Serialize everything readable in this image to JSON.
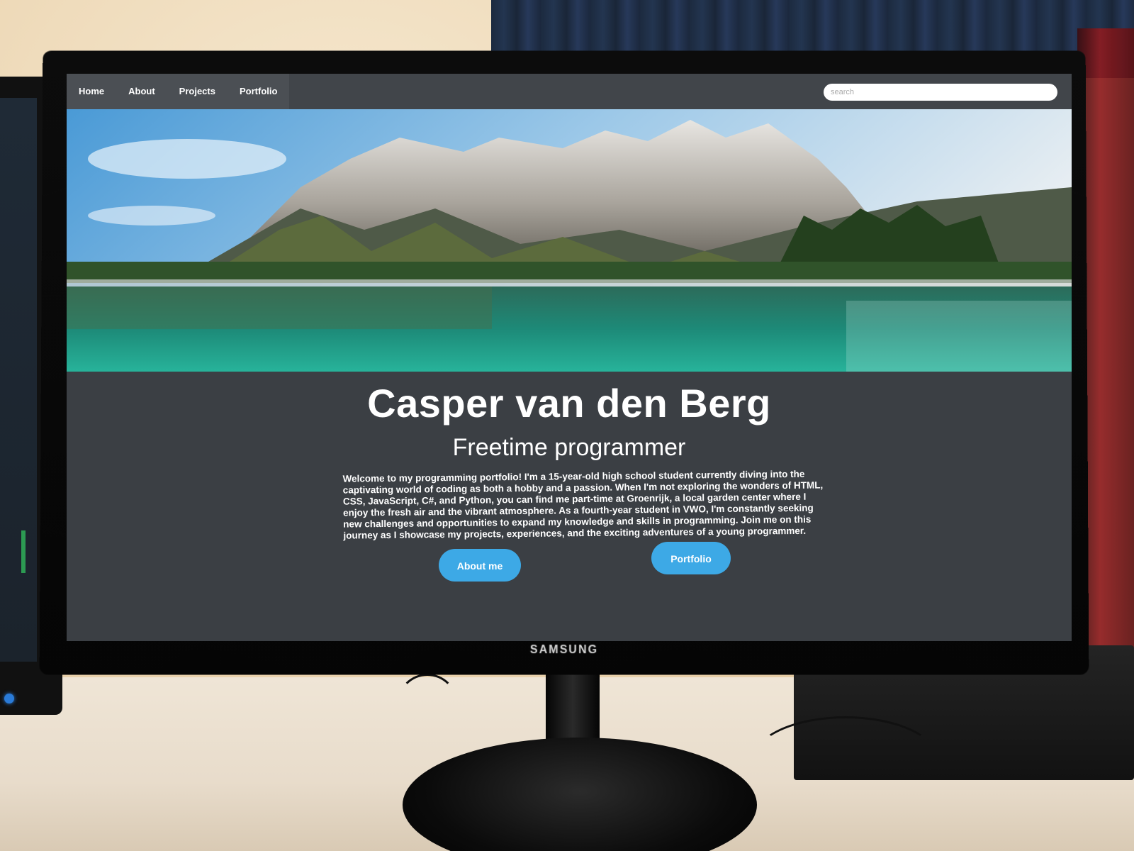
{
  "site": {
    "nav": {
      "links": [
        "Home",
        "About",
        "Projects",
        "Portfolio"
      ],
      "search_placeholder": "search"
    },
    "hero": {
      "title": "Casper van den Berg",
      "subtitle": "Freetime programmer",
      "intro": "Welcome to my programming portfolio! I'm a 15-year-old high school student currently diving into the captivating world of coding as both a hobby and a passion. When I'm not exploring the wonders of HTML, CSS, JavaScript, C#, and Python, you can find me part-time at Groenrijk, a local garden center where I enjoy the fresh air and the vibrant atmosphere. As a fourth-year student in VWO, I'm constantly seeking new challenges and opportunities to expand my knowledge and skills in programming. Join me on this journey as I showcase my projects, experiences, and the exciting adventures of a young programmer.",
      "buttons": {
        "about": "About me",
        "portfolio": "Portfolio"
      }
    }
  },
  "monitor": {
    "brand": "SAMSUNG"
  },
  "colors": {
    "page_bg": "#3b3f44",
    "navbar": "#41454a",
    "button": "#3da9e6",
    "text": "#ffffff"
  }
}
